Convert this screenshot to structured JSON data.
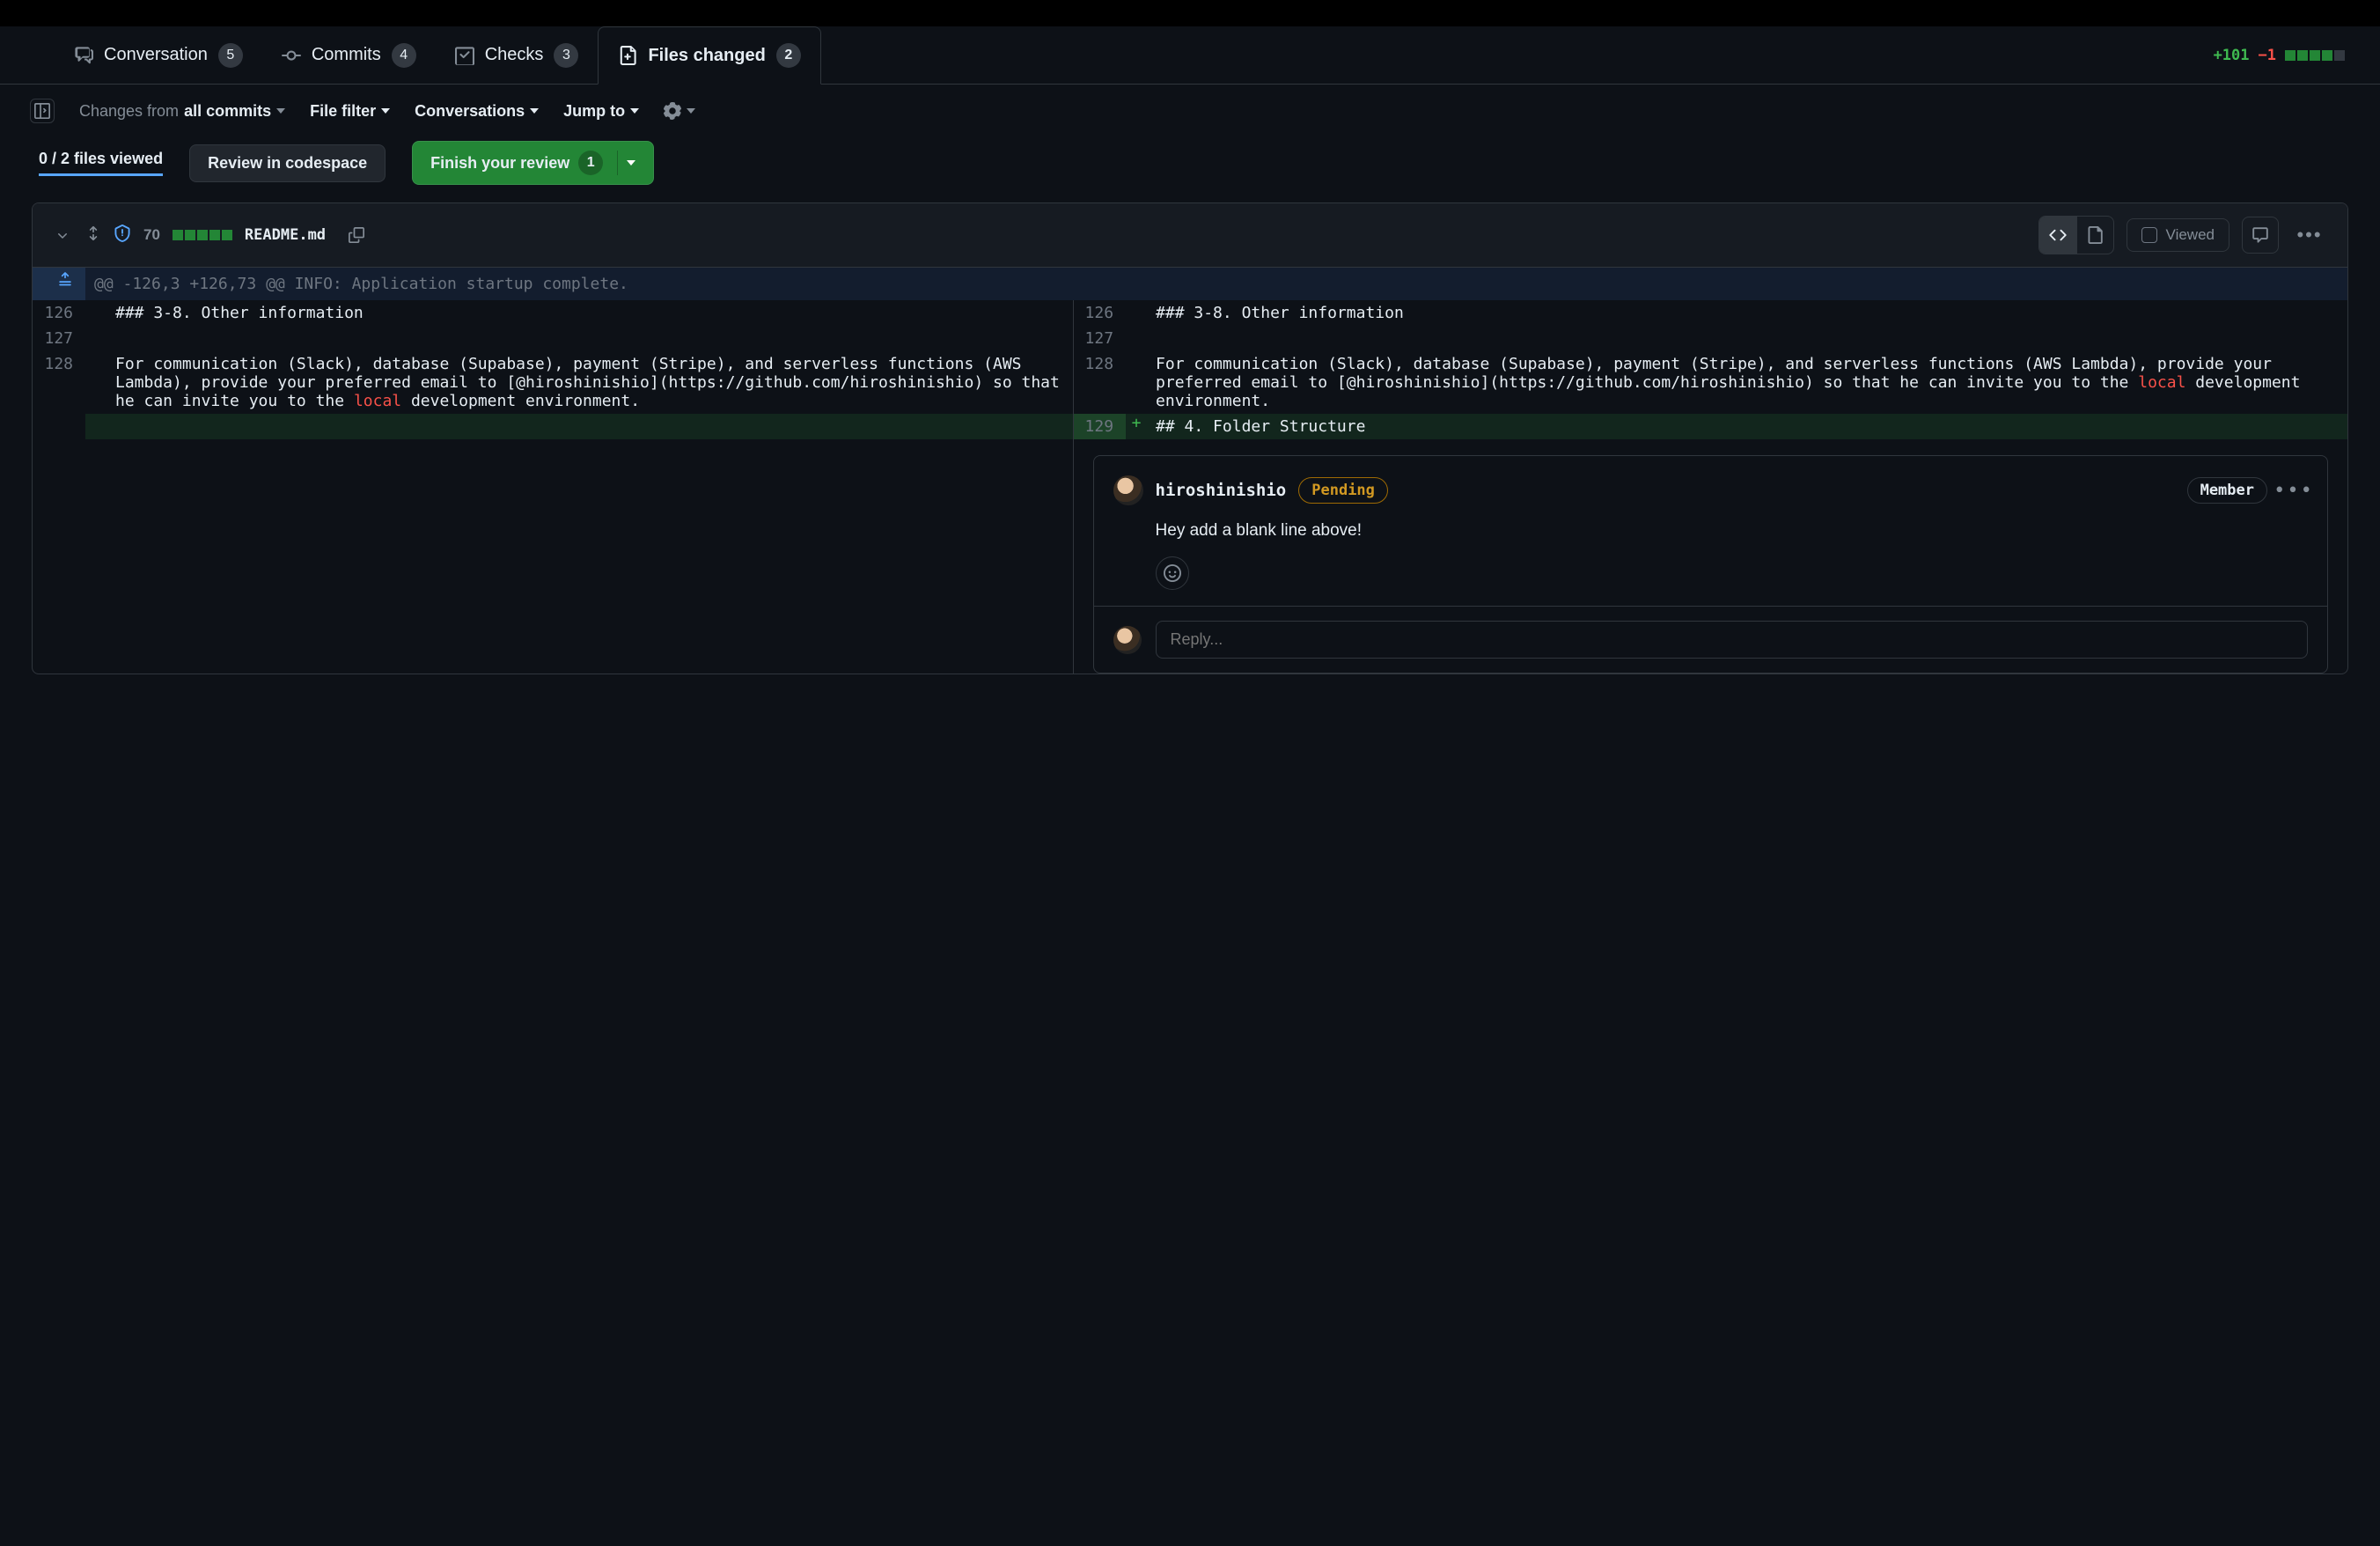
{
  "tabs": {
    "conversation": {
      "label": "Conversation",
      "count": "5"
    },
    "commits": {
      "label": "Commits",
      "count": "4"
    },
    "checks": {
      "label": "Checks",
      "count": "3"
    },
    "files": {
      "label": "Files changed",
      "count": "2"
    }
  },
  "stats": {
    "additions": "+101",
    "deletions": "−1"
  },
  "toolbar": {
    "changes_from_prefix": "Changes from ",
    "changes_from_value": "all commits",
    "file_filter": "File filter",
    "conversations": "Conversations",
    "jump_to": "Jump to"
  },
  "review": {
    "files_viewed": "0 / 2 files viewed",
    "codespace": "Review in codespace",
    "finish": "Finish your review",
    "finish_count": "1"
  },
  "file": {
    "name": "README.md",
    "change_count": "70",
    "viewed_label": "Viewed"
  },
  "hunk": {
    "header": "@@ -126,3 +126,73 @@ INFO:     Application startup complete."
  },
  "left": {
    "l126": "126",
    "l127": "127",
    "l128": "128",
    "t126": "### 3-8. Other information",
    "t128a": "For communication (Slack), database (Supabase), payment (Stripe), and serverless functions (AWS Lambda), provide your preferred email to [@hiroshinishio](https://github.com/hiroshinishio) so that he can invite you to the ",
    "t128kw": "local",
    "t128b": " development environment."
  },
  "right": {
    "l126": "126",
    "l127": "127",
    "l128": "128",
    "l129": "129",
    "t126": "### 3-8. Other information",
    "t128a": "For communication (Slack), database (Supabase), payment (Stripe), and serverless functions (AWS Lambda), provide your preferred email to [@hiroshinishio](https://github.com/hiroshinishio) so that he can invite you to the ",
    "t128kw": "local",
    "t128b": " development environment.",
    "t129": "## 4. Folder Structure"
  },
  "comment": {
    "author": "hiroshinishio",
    "status": "Pending",
    "role": "Member",
    "body": "Hey add a blank line above!",
    "reply_placeholder": "Reply..."
  }
}
